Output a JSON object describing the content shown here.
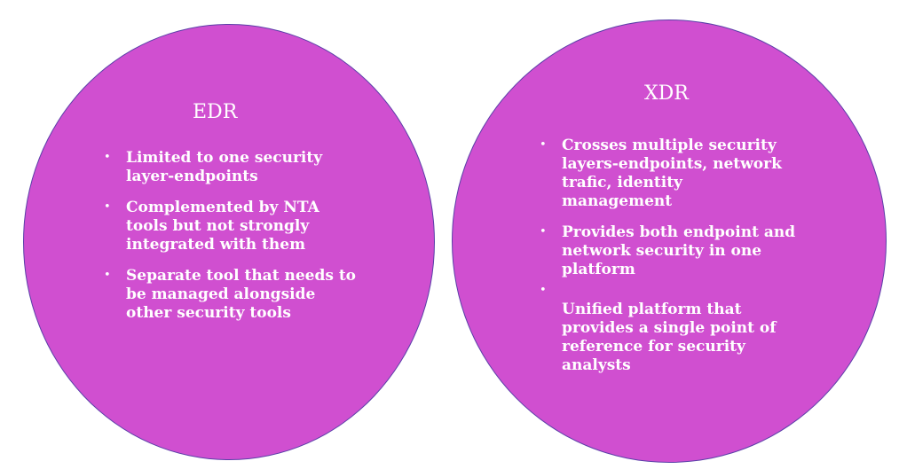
{
  "colors": {
    "circle_fill": "#d04fd0",
    "circle_border": "#5a3fa8",
    "text": "#ffffff",
    "background": "#ffffff"
  },
  "edr": {
    "title": "EDR",
    "items": [
      "Limited to one security layer-endpoints",
      "Complemented by NTA tools but not strongly integrated with them",
      "Separate tool that needs to be managed alongside other security tools"
    ]
  },
  "xdr": {
    "title": "XDR",
    "items": [
      "Crosses multiple security layers-endpoints, network trafic, identity management",
      "Provides both endpoint and network security in one platform",
      "Unified platform that provides a single point of reference for security analysts"
    ]
  },
  "bullet": "•"
}
